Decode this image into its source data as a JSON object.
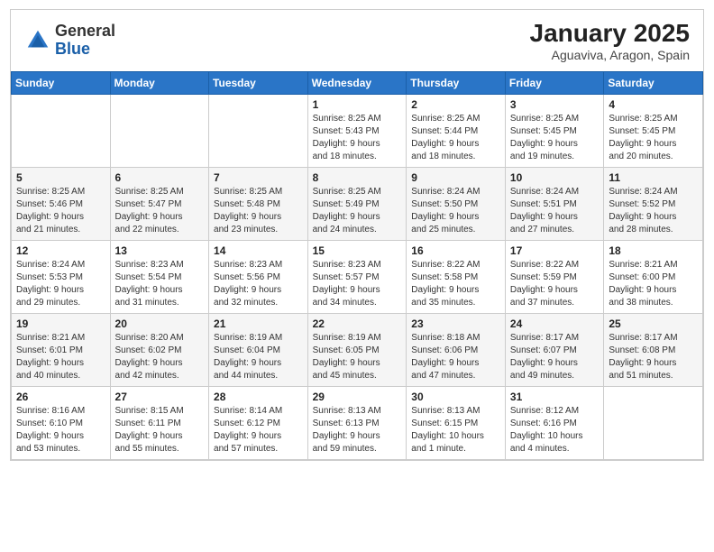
{
  "header": {
    "logo_general": "General",
    "logo_blue": "Blue",
    "month": "January 2025",
    "location": "Aguaviva, Aragon, Spain"
  },
  "days_of_week": [
    "Sunday",
    "Monday",
    "Tuesday",
    "Wednesday",
    "Thursday",
    "Friday",
    "Saturday"
  ],
  "weeks": [
    [
      {
        "day": "",
        "info": ""
      },
      {
        "day": "",
        "info": ""
      },
      {
        "day": "",
        "info": ""
      },
      {
        "day": "1",
        "info": "Sunrise: 8:25 AM\nSunset: 5:43 PM\nDaylight: 9 hours\nand 18 minutes."
      },
      {
        "day": "2",
        "info": "Sunrise: 8:25 AM\nSunset: 5:44 PM\nDaylight: 9 hours\nand 18 minutes."
      },
      {
        "day": "3",
        "info": "Sunrise: 8:25 AM\nSunset: 5:45 PM\nDaylight: 9 hours\nand 19 minutes."
      },
      {
        "day": "4",
        "info": "Sunrise: 8:25 AM\nSunset: 5:45 PM\nDaylight: 9 hours\nand 20 minutes."
      }
    ],
    [
      {
        "day": "5",
        "info": "Sunrise: 8:25 AM\nSunset: 5:46 PM\nDaylight: 9 hours\nand 21 minutes."
      },
      {
        "day": "6",
        "info": "Sunrise: 8:25 AM\nSunset: 5:47 PM\nDaylight: 9 hours\nand 22 minutes."
      },
      {
        "day": "7",
        "info": "Sunrise: 8:25 AM\nSunset: 5:48 PM\nDaylight: 9 hours\nand 23 minutes."
      },
      {
        "day": "8",
        "info": "Sunrise: 8:25 AM\nSunset: 5:49 PM\nDaylight: 9 hours\nand 24 minutes."
      },
      {
        "day": "9",
        "info": "Sunrise: 8:24 AM\nSunset: 5:50 PM\nDaylight: 9 hours\nand 25 minutes."
      },
      {
        "day": "10",
        "info": "Sunrise: 8:24 AM\nSunset: 5:51 PM\nDaylight: 9 hours\nand 27 minutes."
      },
      {
        "day": "11",
        "info": "Sunrise: 8:24 AM\nSunset: 5:52 PM\nDaylight: 9 hours\nand 28 minutes."
      }
    ],
    [
      {
        "day": "12",
        "info": "Sunrise: 8:24 AM\nSunset: 5:53 PM\nDaylight: 9 hours\nand 29 minutes."
      },
      {
        "day": "13",
        "info": "Sunrise: 8:23 AM\nSunset: 5:54 PM\nDaylight: 9 hours\nand 31 minutes."
      },
      {
        "day": "14",
        "info": "Sunrise: 8:23 AM\nSunset: 5:56 PM\nDaylight: 9 hours\nand 32 minutes."
      },
      {
        "day": "15",
        "info": "Sunrise: 8:23 AM\nSunset: 5:57 PM\nDaylight: 9 hours\nand 34 minutes."
      },
      {
        "day": "16",
        "info": "Sunrise: 8:22 AM\nSunset: 5:58 PM\nDaylight: 9 hours\nand 35 minutes."
      },
      {
        "day": "17",
        "info": "Sunrise: 8:22 AM\nSunset: 5:59 PM\nDaylight: 9 hours\nand 37 minutes."
      },
      {
        "day": "18",
        "info": "Sunrise: 8:21 AM\nSunset: 6:00 PM\nDaylight: 9 hours\nand 38 minutes."
      }
    ],
    [
      {
        "day": "19",
        "info": "Sunrise: 8:21 AM\nSunset: 6:01 PM\nDaylight: 9 hours\nand 40 minutes."
      },
      {
        "day": "20",
        "info": "Sunrise: 8:20 AM\nSunset: 6:02 PM\nDaylight: 9 hours\nand 42 minutes."
      },
      {
        "day": "21",
        "info": "Sunrise: 8:19 AM\nSunset: 6:04 PM\nDaylight: 9 hours\nand 44 minutes."
      },
      {
        "day": "22",
        "info": "Sunrise: 8:19 AM\nSunset: 6:05 PM\nDaylight: 9 hours\nand 45 minutes."
      },
      {
        "day": "23",
        "info": "Sunrise: 8:18 AM\nSunset: 6:06 PM\nDaylight: 9 hours\nand 47 minutes."
      },
      {
        "day": "24",
        "info": "Sunrise: 8:17 AM\nSunset: 6:07 PM\nDaylight: 9 hours\nand 49 minutes."
      },
      {
        "day": "25",
        "info": "Sunrise: 8:17 AM\nSunset: 6:08 PM\nDaylight: 9 hours\nand 51 minutes."
      }
    ],
    [
      {
        "day": "26",
        "info": "Sunrise: 8:16 AM\nSunset: 6:10 PM\nDaylight: 9 hours\nand 53 minutes."
      },
      {
        "day": "27",
        "info": "Sunrise: 8:15 AM\nSunset: 6:11 PM\nDaylight: 9 hours\nand 55 minutes."
      },
      {
        "day": "28",
        "info": "Sunrise: 8:14 AM\nSunset: 6:12 PM\nDaylight: 9 hours\nand 57 minutes."
      },
      {
        "day": "29",
        "info": "Sunrise: 8:13 AM\nSunset: 6:13 PM\nDaylight: 9 hours\nand 59 minutes."
      },
      {
        "day": "30",
        "info": "Sunrise: 8:13 AM\nSunset: 6:15 PM\nDaylight: 10 hours\nand 1 minute."
      },
      {
        "day": "31",
        "info": "Sunrise: 8:12 AM\nSunset: 6:16 PM\nDaylight: 10 hours\nand 4 minutes."
      },
      {
        "day": "",
        "info": ""
      }
    ]
  ]
}
